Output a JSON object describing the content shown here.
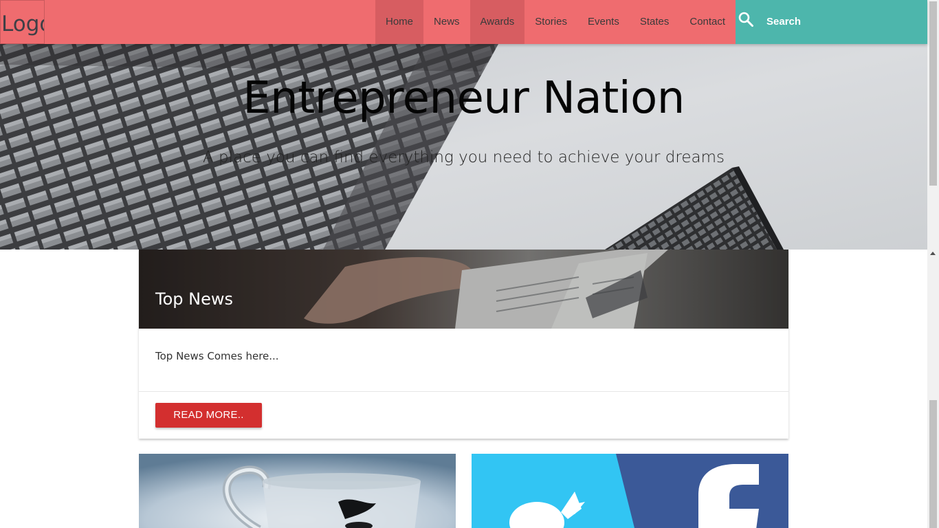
{
  "navbar": {
    "logo": "Logo",
    "items": [
      {
        "label": "Home",
        "active": true
      },
      {
        "label": "News",
        "active": false
      },
      {
        "label": "Awards",
        "active": true
      },
      {
        "label": "Stories",
        "active": false
      },
      {
        "label": "Events",
        "active": false
      },
      {
        "label": "States",
        "active": false
      },
      {
        "label": "Contact",
        "active": false
      }
    ],
    "search_label": "Search",
    "search_icon": "search-icon"
  },
  "hero": {
    "title": "Entrepreneur Nation",
    "subtitle": "A place you can find everything you need to achieve your dreams"
  },
  "top_news": {
    "title": "Top News",
    "content": "Top News Comes here...",
    "button_label": "READ MORE.."
  },
  "colors": {
    "navbar": "#ef6c6f",
    "navbar_active": "#d75d61",
    "search": "#4db6ac",
    "button": "#d32f2f"
  }
}
